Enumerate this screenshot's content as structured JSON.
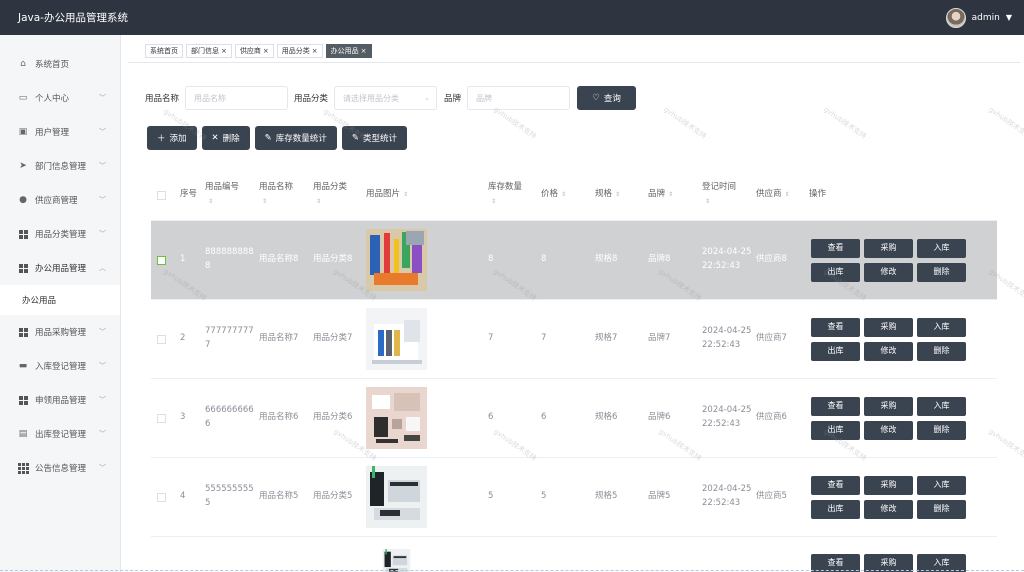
{
  "app": {
    "title": "Java-办公用品管理系统",
    "user": "admin"
  },
  "sidebar": {
    "items": [
      {
        "label": "系统首页",
        "icon": "home-icon",
        "chev": false
      },
      {
        "label": "个人中心",
        "icon": "card-icon",
        "chev": true
      },
      {
        "label": "用户管理",
        "icon": "stamp-icon",
        "chev": true
      },
      {
        "label": "部门信息管理",
        "icon": "send-icon",
        "chev": true
      },
      {
        "label": "供应商管理",
        "icon": "user-icon",
        "chev": true
      },
      {
        "label": "用品分类管理",
        "icon": "grid-icon",
        "chev": true
      },
      {
        "label": "办公用品管理",
        "icon": "grid-icon",
        "chev": true,
        "open": true
      }
    ],
    "sub_item": "办公用品",
    "items_after": [
      {
        "label": "用品采购管理",
        "icon": "grid-icon"
      },
      {
        "label": "入库登记管理",
        "icon": "briefcase-icon"
      },
      {
        "label": "申领用品管理",
        "icon": "grid-icon"
      },
      {
        "label": "出库登记管理",
        "icon": "clipboard-icon"
      },
      {
        "label": "公告信息管理",
        "icon": "grid9-icon"
      }
    ]
  },
  "tabs": [
    {
      "label": "系统首页",
      "closable": false
    },
    {
      "label": "部门信息",
      "closable": true
    },
    {
      "label": "供应商",
      "closable": true
    },
    {
      "label": "用品分类",
      "closable": true
    },
    {
      "label": "办公用品",
      "closable": true,
      "active": true
    }
  ],
  "search": {
    "name_label": "用品名称",
    "name_placeholder": "用品名称",
    "category_label": "用品分类",
    "category_placeholder": "请选择用品分类",
    "brand_label": "品牌",
    "brand_placeholder": "品牌",
    "query_button": "查询"
  },
  "toolbar": {
    "add": "添加",
    "delete": "删除",
    "stock_stats": "库存数量统计",
    "type_stats": "类型统计"
  },
  "table": {
    "headers": {
      "index": "序号",
      "code": "用品编号",
      "name": "用品名称",
      "category": "用品分类",
      "image": "用品图片",
      "stock": "库存数量",
      "price": "价格",
      "spec": "规格",
      "brand": "品牌",
      "time": "登记时间",
      "supplier": "供应商",
      "ops": "操作"
    },
    "op_labels": {
      "view": "查看",
      "purchase": "采购",
      "in": "入库",
      "out": "出库",
      "edit": "修改",
      "del": "删除"
    },
    "rows": [
      {
        "index": "1",
        "code": "8888888888",
        "name": "用品名称8",
        "category": "用品分类8",
        "stock": "8",
        "price": "8",
        "spec": "规格8",
        "brand": "品牌8",
        "time": "2024-04-25 22:52:43",
        "supplier": "供应商8",
        "highlight": true,
        "image": "pens-image"
      },
      {
        "index": "2",
        "code": "7777777777",
        "name": "用品名称7",
        "category": "用品分类7",
        "stock": "7",
        "price": "7",
        "spec": "规格7",
        "brand": "品牌7",
        "time": "2024-04-25 22:52:43",
        "supplier": "供应商7",
        "image": "organizer-image"
      },
      {
        "index": "3",
        "code": "6666666666",
        "name": "用品名称6",
        "category": "用品分类6",
        "stock": "6",
        "price": "6",
        "spec": "规格6",
        "brand": "品牌6",
        "time": "2024-04-25 22:52:43",
        "supplier": "供应商6",
        "image": "flatlay-image"
      },
      {
        "index": "4",
        "code": "5555555555",
        "name": "用品名称5",
        "category": "用品分类5",
        "stock": "5",
        "price": "5",
        "spec": "规格5",
        "brand": "品牌5",
        "time": "2024-04-25 22:52:43",
        "supplier": "供应商5",
        "image": "desk-set-image"
      },
      {
        "index": "",
        "code": "",
        "name": "",
        "category": "",
        "stock": "",
        "price": "",
        "spec": "",
        "brand": "",
        "time": "",
        "supplier": "",
        "image": "desk-set-image",
        "partial": true
      }
    ]
  },
  "watermark": "gvhub技术支持",
  "colors": {
    "topbar": "#2e3440",
    "button": "#3a4350",
    "highlight_row": "#d0d1d3",
    "sidebar": "#f5f6f8"
  }
}
